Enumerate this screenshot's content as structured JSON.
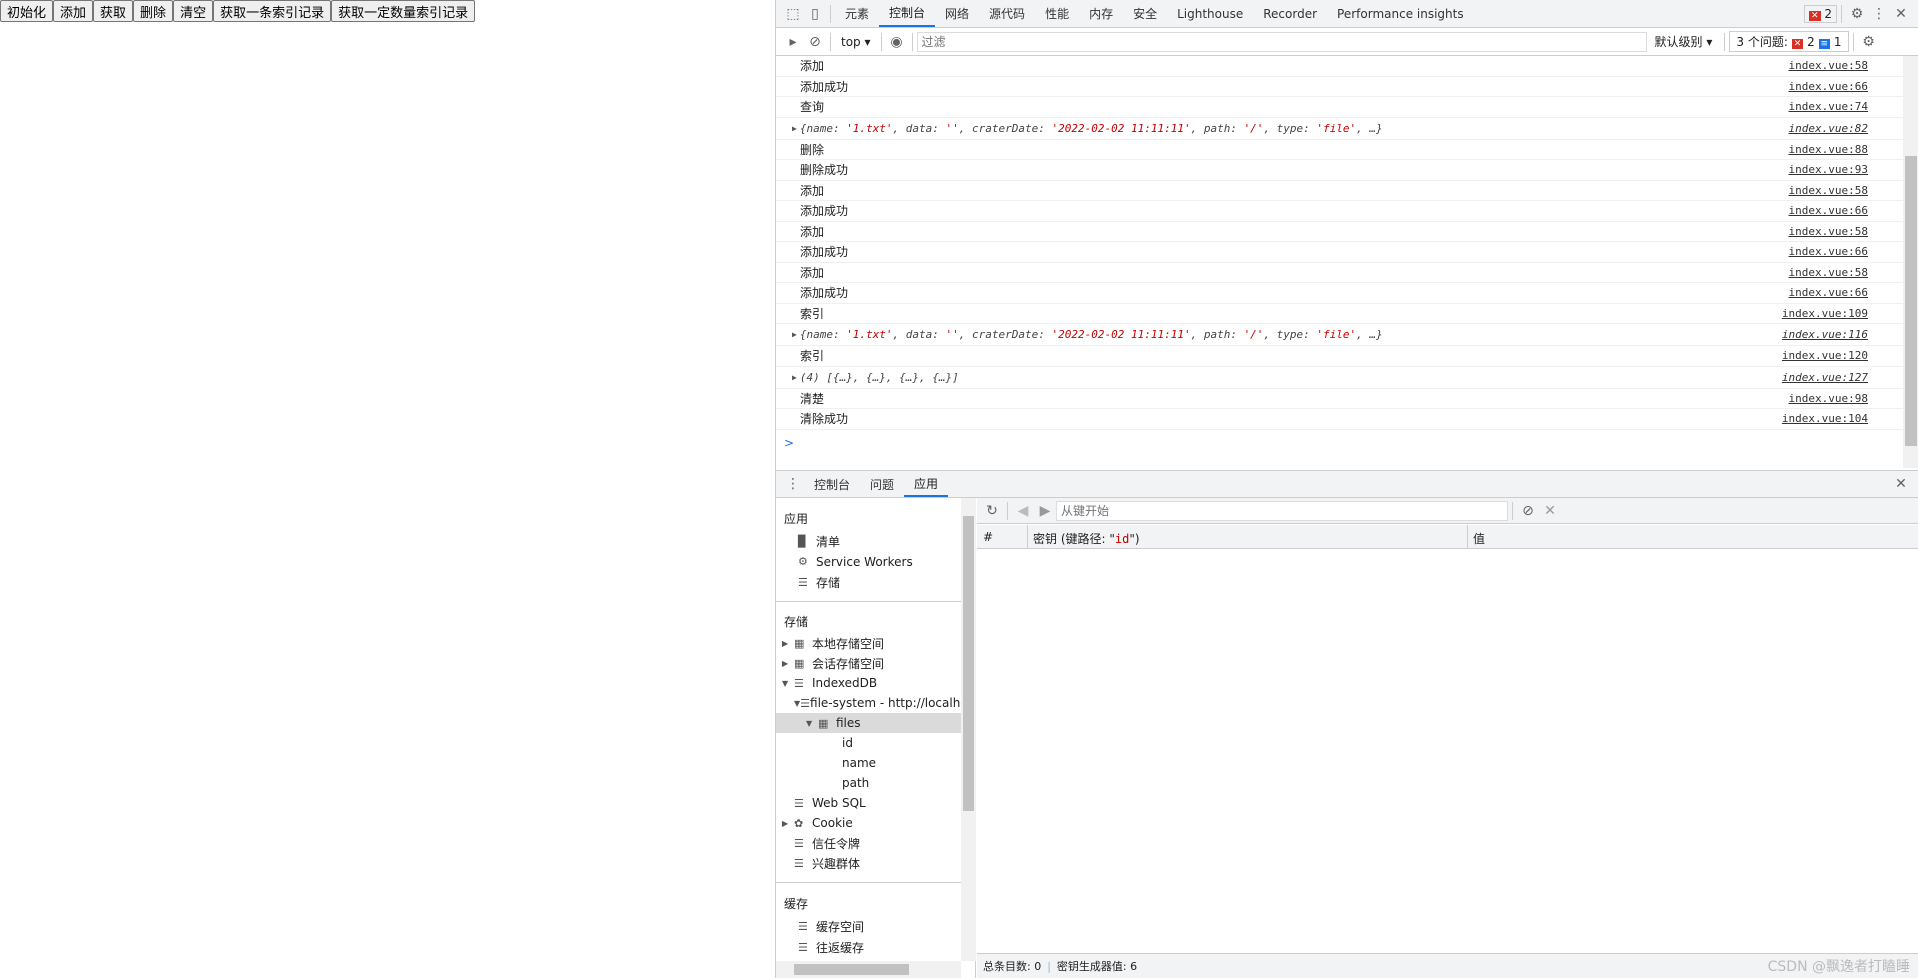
{
  "page": {
    "buttons": [
      "初始化",
      "添加",
      "获取",
      "删除",
      "清空",
      "获取一条索引记录",
      "获取一定数量索引记录"
    ]
  },
  "devtools": {
    "tabs": [
      "元素",
      "控制台",
      "网络",
      "源代码",
      "性能",
      "内存",
      "安全",
      "Lighthouse",
      "Recorder",
      "Performance insights"
    ],
    "active_tab": "控制台",
    "error_badge": "2",
    "toolbar": {
      "context": "top",
      "filter_placeholder": "过滤",
      "level": "默认级别",
      "issues_label": "3 个问题:",
      "issues_errors": "2",
      "issues_info": "1"
    },
    "console": [
      {
        "text": "添加",
        "src": "index.vue:58"
      },
      {
        "text": "添加成功",
        "src": "index.vue:66"
      },
      {
        "text": "查询",
        "src": "index.vue:74"
      },
      {
        "obj": true,
        "text": "{name: '1.txt', data: '', craterDate: '2022-02-02 11:11:11', path: '/', type: 'file', …}",
        "src": "index.vue:82"
      },
      {
        "text": "删除",
        "src": "index.vue:88"
      },
      {
        "text": "删除成功",
        "src": "index.vue:93"
      },
      {
        "text": "添加",
        "src": "index.vue:58"
      },
      {
        "text": "添加成功",
        "src": "index.vue:66"
      },
      {
        "text": "添加",
        "src": "index.vue:58"
      },
      {
        "text": "添加成功",
        "src": "index.vue:66"
      },
      {
        "text": "添加",
        "src": "index.vue:58"
      },
      {
        "text": "添加成功",
        "src": "index.vue:66"
      },
      {
        "text": "索引",
        "src": "index.vue:109"
      },
      {
        "obj": true,
        "text": "{name: '1.txt', data: '', craterDate: '2022-02-02 11:11:11', path: '/', type: 'file', …}",
        "src": "index.vue:116"
      },
      {
        "text": "索引",
        "src": "index.vue:120"
      },
      {
        "obj": true,
        "text": "(4) [{…}, {…}, {…}, {…}]",
        "src": "index.vue:127"
      },
      {
        "text": "清楚",
        "src": "index.vue:98"
      },
      {
        "text": "清除成功",
        "src": "index.vue:104"
      }
    ],
    "prompt": ">",
    "drawer_tabs": [
      "控制台",
      "问题",
      "应用"
    ],
    "drawer_active": "应用",
    "sidebar": {
      "app_heading": "应用",
      "app_items": [
        {
          "label": "清单",
          "icon": "file-icon"
        },
        {
          "label": "Service Workers",
          "icon": "gear-icon"
        },
        {
          "label": "存储",
          "icon": "database-icon"
        }
      ],
      "storage_heading": "存储",
      "storage_items": [
        {
          "label": "本地存储空间",
          "icon": "grid-icon",
          "arrow": "▶",
          "depth": 0
        },
        {
          "label": "会话存储空间",
          "icon": "grid-icon",
          "arrow": "▶",
          "depth": 0
        },
        {
          "label": "IndexedDB",
          "icon": "database-icon",
          "arrow": "▼",
          "depth": 0
        },
        {
          "label": "file-system - http://localhost",
          "icon": "database-icon",
          "arrow": "▼",
          "depth": 1
        },
        {
          "label": "files",
          "icon": "grid-icon",
          "arrow": "▼",
          "depth": 2,
          "selected": true
        },
        {
          "label": "id",
          "depth": 3
        },
        {
          "label": "name",
          "depth": 3
        },
        {
          "label": "path",
          "depth": 3
        },
        {
          "label": "Web SQL",
          "icon": "database-icon",
          "depth": 0
        },
        {
          "label": "Cookie",
          "icon": "cookie-icon",
          "arrow": "▶",
          "depth": 0
        },
        {
          "label": "信任令牌",
          "icon": "database-icon",
          "depth": 0
        },
        {
          "label": "兴趣群体",
          "icon": "database-icon",
          "depth": 0
        }
      ],
      "cache_heading": "缓存",
      "cache_items": [
        {
          "label": "缓存空间",
          "icon": "database-icon"
        },
        {
          "label": "往返缓存",
          "icon": "database-icon"
        }
      ]
    },
    "idb": {
      "key_placeholder": "从键开始",
      "col_num": "#",
      "col_key_prefix": "密钥 (键路径: \"",
      "col_key_path": "id",
      "col_key_suffix": "\")",
      "col_value": "值",
      "footer_total": "总条目数: 0",
      "footer_keygen": "密钥生成器值: 6"
    }
  },
  "watermark": "CSDN @飘逸者打瞌睡"
}
